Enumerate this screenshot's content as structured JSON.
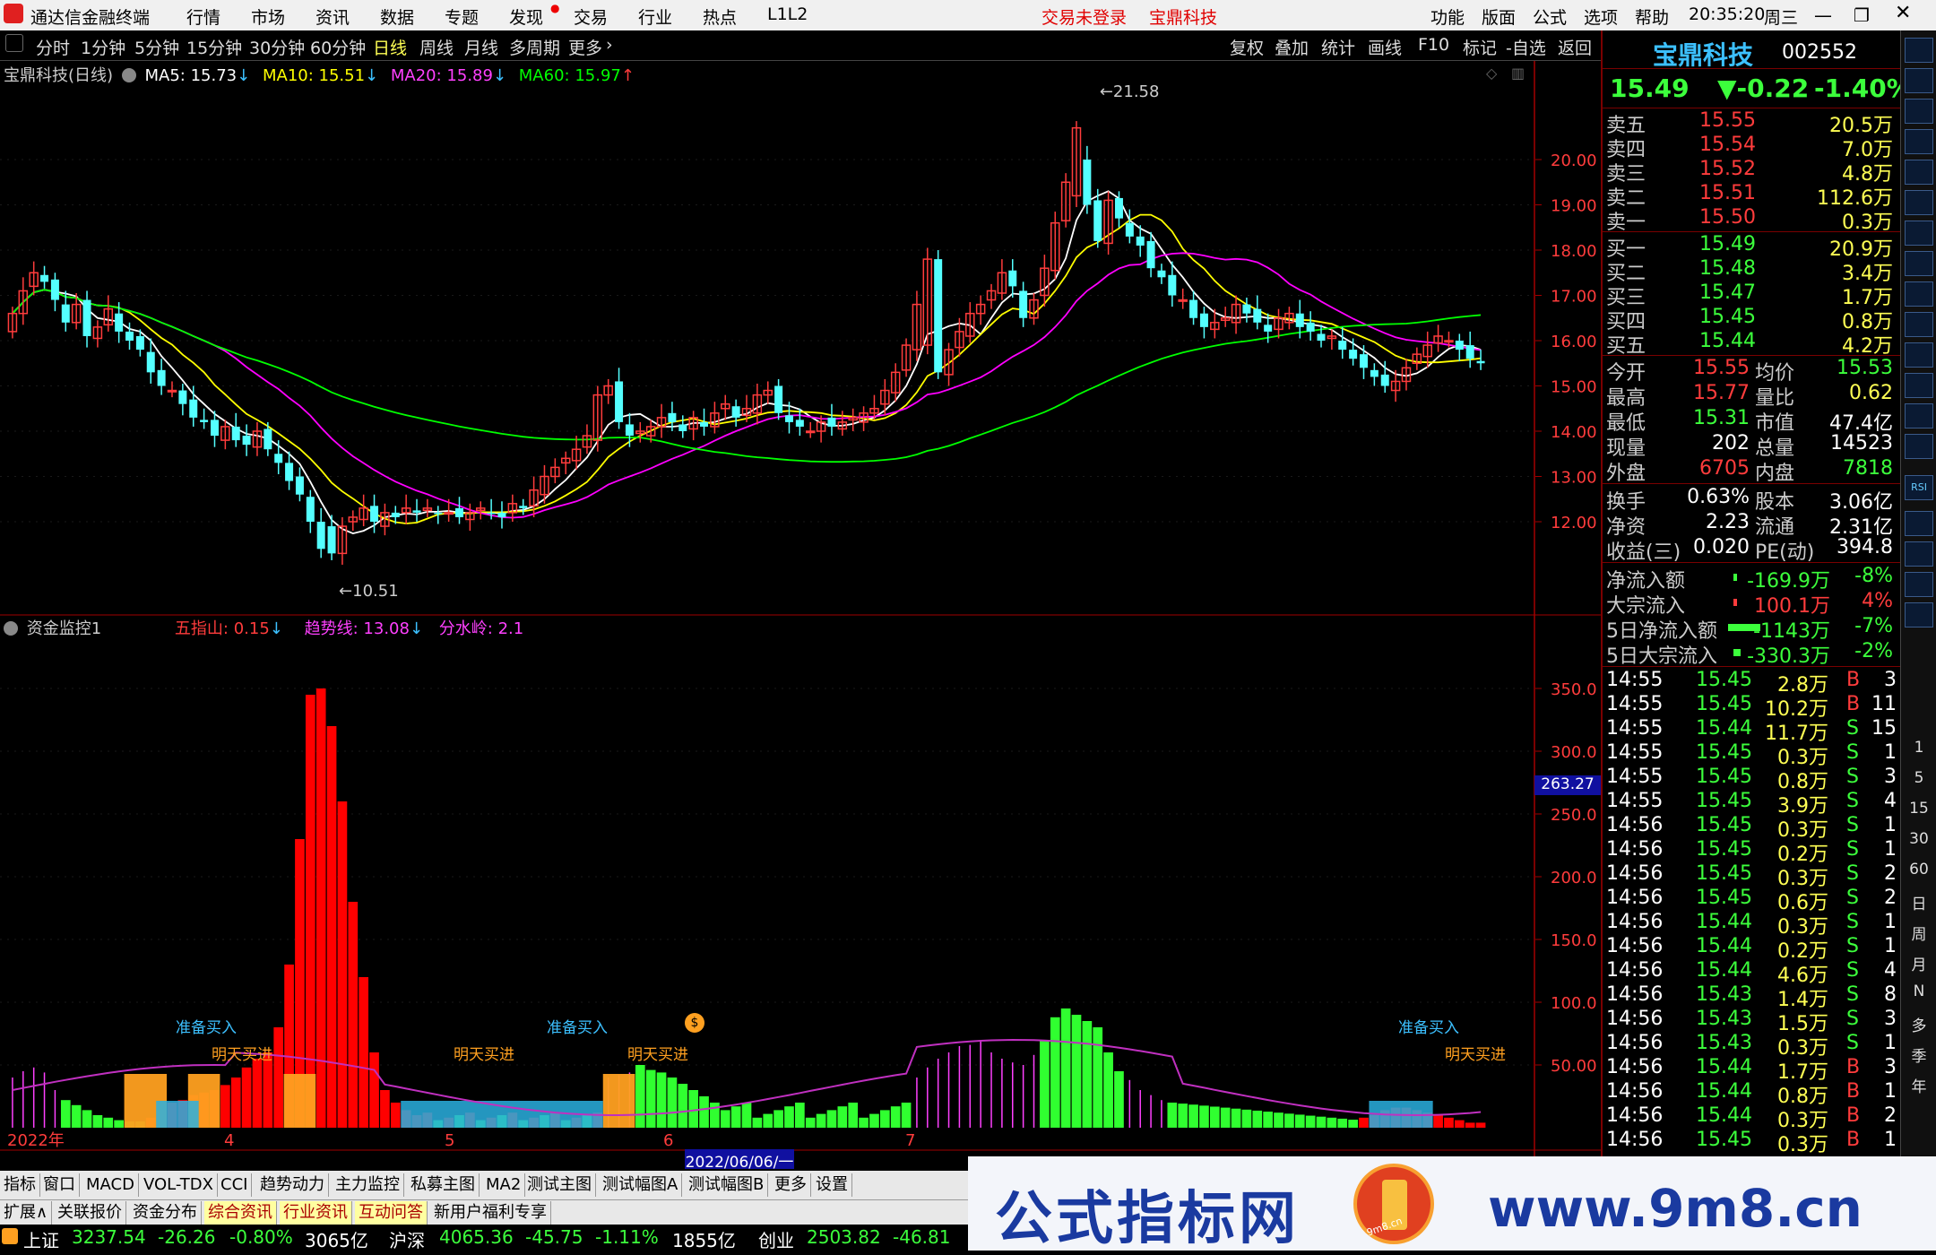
{
  "window": {
    "app_name": "通达信金融终端",
    "menu": [
      "行情",
      "市场",
      "资讯",
      "数据",
      "专题",
      "发现",
      "交易",
      "行业",
      "热点",
      "L1L2"
    ],
    "notice_login": "交易未登录",
    "notice_stock": "宝鼎科技",
    "right_menu": [
      "功能",
      "版面",
      "公式",
      "选项",
      "帮助"
    ],
    "time": "20:35:20",
    "weekday": "周三"
  },
  "period_bar": {
    "periods": [
      "分时",
      "1分钟",
      "5分钟",
      "15分钟",
      "30分钟",
      "60分钟",
      "日线",
      "周线",
      "月线",
      "多周期",
      "更多"
    ],
    "selected": "日线",
    "tools": [
      "复权",
      "叠加",
      "统计",
      "画线",
      "F10",
      "标记",
      "-自选",
      "返回"
    ]
  },
  "kline_header": {
    "name": "宝鼎科技(日线)",
    "ma5": "MA5: 15.73",
    "ma10": "MA10: 15.51",
    "ma20": "MA20: 15.89",
    "ma60": "MA60: 15.97",
    "high_label": "21.58",
    "low_label": "10.51"
  },
  "price_axis": [
    "20.00",
    "19.00",
    "18.00",
    "17.00",
    "16.00",
    "15.00",
    "14.00",
    "13.00",
    "12.00"
  ],
  "fund_header": {
    "name": "资金监控1",
    "wuzhishan": "五指山: 0.15",
    "qushixian": "趋势线: 13.08",
    "fenshuiling": "分水岭: 2.1"
  },
  "fund_axis": [
    "350.0",
    "300.0",
    "250.0",
    "200.0",
    "150.0",
    "100.0",
    "50.00"
  ],
  "fund_cursor_value": "263.27",
  "fund_labels": [
    "准备买入",
    "明天买进",
    "准备买入",
    "明天买进",
    "准备买入",
    "明天买进"
  ],
  "date_axis": {
    "labels": [
      "2022年",
      "4",
      "5",
      "6",
      "7"
    ],
    "cursor_date": "2022/06/06/一"
  },
  "indicator_tabs": [
    "指标",
    "窗口",
    "MACD",
    "VOL-TDX",
    "CCI",
    "趋势动力",
    "主力监控",
    "私募主图",
    "MA2",
    "测试主图",
    "测试幅图A",
    "测试幅图B",
    "更多",
    "设置"
  ],
  "ext_tabs": [
    "扩展∧",
    "关联报价",
    "资金分布",
    "综合资讯",
    "行业资讯",
    "互动问答",
    "新用户福利专享"
  ],
  "status_bar": {
    "sh_name": "上证",
    "sh_value": "3237.54",
    "sh_change": "-26.26",
    "sh_pct": "-0.80%",
    "sh_amount": "3065亿",
    "hs_name": "沪深",
    "hs_value": "4065.36",
    "hs_change": "-45.75",
    "hs_pct": "-1.11%",
    "hs_amount": "1855亿",
    "cy_name": "创业",
    "cy_value": "2503.82",
    "cy_change": "-46.81"
  },
  "quote": {
    "name": "宝鼎科技",
    "code": "002552",
    "price": "15.49",
    "change": "▼-0.22",
    "pct": "-1.40%",
    "asks": [
      {
        "label": "卖五",
        "price": "15.55",
        "vol": "20.5万"
      },
      {
        "label": "卖四",
        "price": "15.54",
        "vol": "7.0万"
      },
      {
        "label": "卖三",
        "price": "15.52",
        "vol": "4.8万"
      },
      {
        "label": "卖二",
        "price": "15.51",
        "vol": "112.6万"
      },
      {
        "label": "卖一",
        "price": "15.50",
        "vol": "0.3万"
      }
    ],
    "bids": [
      {
        "label": "买一",
        "price": "15.49",
        "vol": "20.9万"
      },
      {
        "label": "买二",
        "price": "15.48",
        "vol": "3.4万"
      },
      {
        "label": "买三",
        "price": "15.47",
        "vol": "1.7万"
      },
      {
        "label": "买四",
        "price": "15.45",
        "vol": "0.8万"
      },
      {
        "label": "买五",
        "price": "15.44",
        "vol": "4.2万"
      }
    ],
    "stats1": [
      {
        "l1": "今开",
        "v1": "15.55",
        "l2": "均价",
        "v2": "15.53"
      },
      {
        "l1": "最高",
        "v1": "15.77",
        "l2": "量比",
        "v2": "0.62"
      },
      {
        "l1": "最低",
        "v1": "15.31",
        "l2": "市值",
        "v2": "47.4亿"
      },
      {
        "l1": "现量",
        "v1": "202",
        "l2": "总量",
        "v2": "14523"
      },
      {
        "l1": "外盘",
        "v1": "6705",
        "l2": "内盘",
        "v2": "7818"
      }
    ],
    "stats2": [
      {
        "l1": "换手",
        "v1": "0.63%",
        "l2": "股本",
        "v2": "3.06亿"
      },
      {
        "l1": "净资",
        "v1": "2.23",
        "l2": "流通",
        "v2": "2.31亿"
      },
      {
        "l1": "收益(三)",
        "v1": "0.020",
        "l2": "PE(动)",
        "v2": "394.8"
      }
    ],
    "flows": [
      {
        "label": "净流入额",
        "value": "-169.9万",
        "pct": "-8%"
      },
      {
        "label": "大宗流入",
        "value": "100.1万",
        "pct": "4%"
      },
      {
        "label": "5日净流入额",
        "value": "-1143万",
        "pct": "-7%"
      },
      {
        "label": "5日大宗流入",
        "value": "-330.3万",
        "pct": "-2%"
      }
    ],
    "ticks": [
      {
        "t": "14:55",
        "p": "15.45",
        "v": "2.8万",
        "s": "B",
        "n": "3"
      },
      {
        "t": "14:55",
        "p": "15.45",
        "v": "10.2万",
        "s": "B",
        "n": "11"
      },
      {
        "t": "14:55",
        "p": "15.44",
        "v": "11.7万",
        "s": "S",
        "n": "15"
      },
      {
        "t": "14:55",
        "p": "15.45",
        "v": "0.3万",
        "s": "S",
        "n": "1"
      },
      {
        "t": "14:55",
        "p": "15.45",
        "v": "0.8万",
        "s": "S",
        "n": "3"
      },
      {
        "t": "14:55",
        "p": "15.45",
        "v": "3.9万",
        "s": "S",
        "n": "4"
      },
      {
        "t": "14:56",
        "p": "15.45",
        "v": "0.3万",
        "s": "S",
        "n": "1"
      },
      {
        "t": "14:56",
        "p": "15.45",
        "v": "0.2万",
        "s": "S",
        "n": "1"
      },
      {
        "t": "14:56",
        "p": "15.45",
        "v": "0.3万",
        "s": "S",
        "n": "2"
      },
      {
        "t": "14:56",
        "p": "15.45",
        "v": "0.6万",
        "s": "S",
        "n": "2"
      },
      {
        "t": "14:56",
        "p": "15.44",
        "v": "0.3万",
        "s": "S",
        "n": "1"
      },
      {
        "t": "14:56",
        "p": "15.44",
        "v": "0.2万",
        "s": "S",
        "n": "1"
      },
      {
        "t": "14:56",
        "p": "15.44",
        "v": "4.6万",
        "s": "S",
        "n": "4"
      },
      {
        "t": "14:56",
        "p": "15.43",
        "v": "1.4万",
        "s": "S",
        "n": "8"
      },
      {
        "t": "14:56",
        "p": "15.43",
        "v": "1.5万",
        "s": "S",
        "n": "3"
      },
      {
        "t": "14:56",
        "p": "15.43",
        "v": "0.3万",
        "s": "S",
        "n": "1"
      },
      {
        "t": "14:56",
        "p": "15.44",
        "v": "1.7万",
        "s": "B",
        "n": "3"
      },
      {
        "t": "14:56",
        "p": "15.44",
        "v": "0.8万",
        "s": "B",
        "n": "1"
      },
      {
        "t": "14:56",
        "p": "15.44",
        "v": "0.3万",
        "s": "B",
        "n": "2"
      },
      {
        "t": "14:56",
        "p": "15.45",
        "v": "0.3万",
        "s": "B",
        "n": "1"
      }
    ]
  },
  "side_icons": [
    "RSI"
  ],
  "side_text": [
    "1",
    "5",
    "15",
    "30",
    "60",
    "日",
    "周",
    "月",
    "N",
    "多",
    "季",
    "年"
  ],
  "banner": {
    "title": "公式指标网",
    "url": "www.9m8.cn",
    "logo_text": "9m8.cn"
  },
  "colors": {
    "up": "#ff3c3c",
    "down": "#54ffff",
    "ma5": "#ffffff",
    "ma10": "#ffff00",
    "ma20": "#ff00ff",
    "ma60": "#00ff00",
    "accent_red": "#ff0000"
  }
}
